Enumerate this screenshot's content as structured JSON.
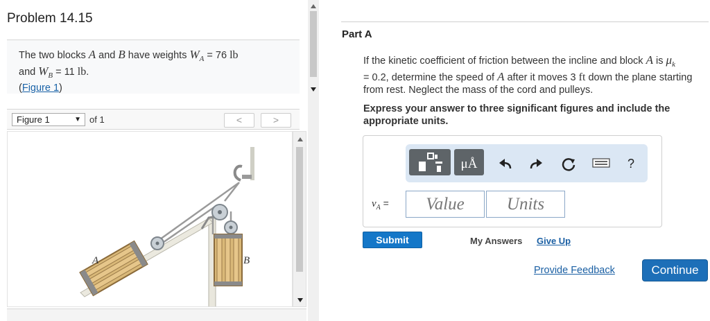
{
  "problem": {
    "title": "Problem 14.15"
  },
  "intro": {
    "text_1": "The two blocks ",
    "var_a": "A",
    "text_2": " and ",
    "var_b": "B",
    "text_3": " have weights ",
    "wa_sym": "W",
    "wa_sub": "A",
    "wa_val": " = 76 ",
    "wa_unit": "lb",
    "text_4": "and ",
    "wb_sym": "W",
    "wb_sub": "B",
    "wb_val": " = 11 ",
    "wb_unit": "lb",
    "text_5": ".",
    "fig_open": "(",
    "figure_link": "Figure 1",
    "fig_close": ")"
  },
  "figure_nav": {
    "selected": "Figure 1",
    "of_label": "of 1",
    "prev_glyph": "<",
    "next_glyph": ">"
  },
  "figure": {
    "label_a": "A",
    "label_b": "B"
  },
  "part": {
    "title": "Part A",
    "q1": "If the kinetic coefficient of friction between the incline and block ",
    "q_a": "A",
    "q2": " is ",
    "q_mu": "μ",
    "q_mu_sub": "k",
    "q3": "= 0.2, determine the speed of ",
    "q_a2": "A",
    "q4": " after it moves 3 ",
    "q_ft": "ft",
    "q5": " down the plane starting from rest. Neglect the mass of the cord and pulleys.",
    "instruction": "Express your answer to three significant figures and include the appropriate units."
  },
  "answer": {
    "var": "v",
    "var_sub": "A",
    "equals": " =",
    "value_placeholder": "Value",
    "units_placeholder": "Units",
    "unit_btn_label": "μÅ",
    "help_glyph": "?"
  },
  "actions": {
    "submit": "Submit",
    "my_answers": "My Answers",
    "give_up": "Give Up",
    "feedback": "Provide Feedback",
    "continue": "Continue"
  },
  "colors": {
    "primary_button": "#1477c8",
    "link": "#1a5fa3",
    "toolbar_bg": "#dbe7f4",
    "toolbar_button": "#5e6468"
  }
}
